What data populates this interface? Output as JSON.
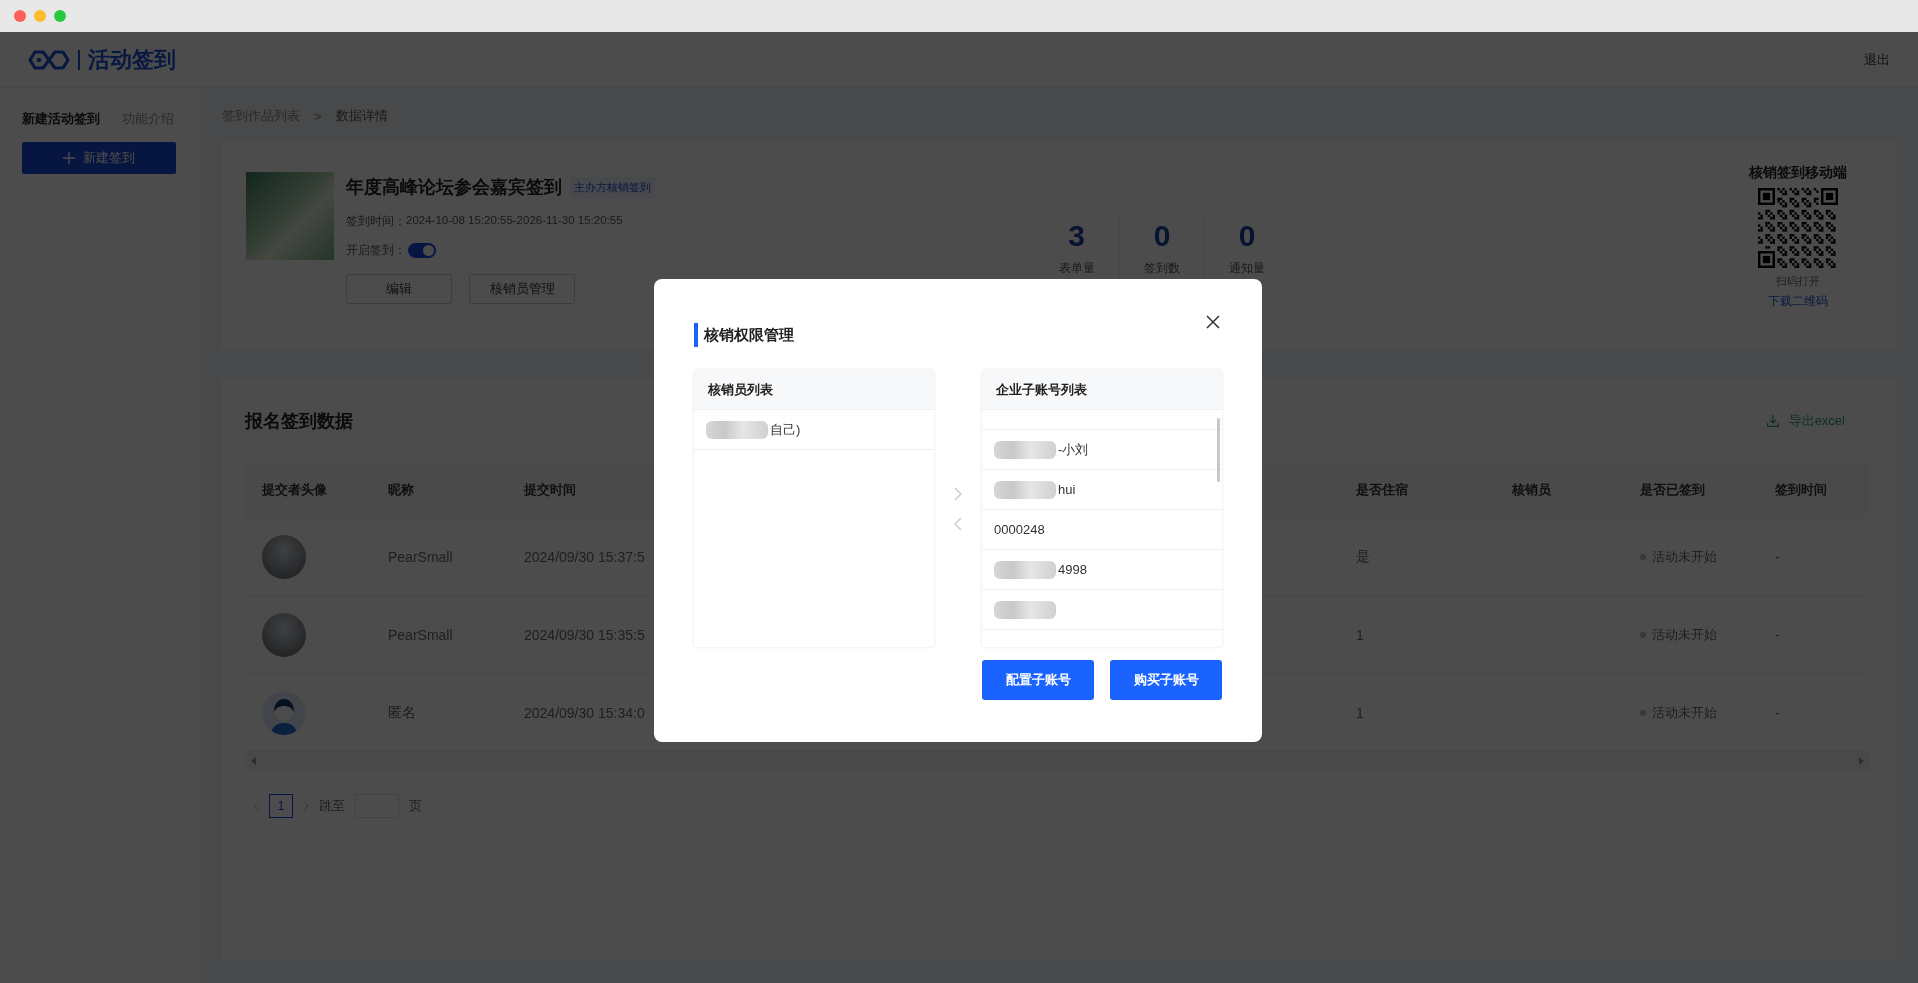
{
  "header": {
    "logo_text": "活动签到",
    "logout": "退出"
  },
  "sidebar": {
    "tabs": [
      {
        "label": "新建活动签到",
        "selected": true
      },
      {
        "label": "功能介绍",
        "selected": false
      }
    ],
    "new_button": "新建签到"
  },
  "breadcrumb": [
    "签到作品列表",
    ">",
    "数据详情"
  ],
  "event": {
    "title": "年度高峰论坛参会嘉宾签到",
    "tag": "主办方核销签到",
    "time_label": "签到时间：",
    "time": "2024-10-08 15:20:55-2026-11-30 15:20:55",
    "toggle_label": "开启签到：",
    "toggle_on": true,
    "buttons": [
      "编辑",
      "核销员管理"
    ]
  },
  "stats": [
    {
      "value": "3",
      "label": "表单量"
    },
    {
      "value": "0",
      "label": "签到数"
    },
    {
      "value": "0",
      "label": "通知量"
    }
  ],
  "mobile": {
    "title": "核销签到移动端",
    "caption": "扫码打开",
    "link": "下载二维码"
  },
  "data": {
    "title": "报名签到数据",
    "export": "导出excel",
    "columns": [
      "提交者头像",
      "昵称",
      "提交时间",
      "是否住宿",
      "核销员",
      "是否已签到",
      "签到时间"
    ],
    "rows": [
      {
        "kind": "photo",
        "nickname": "PearSmall",
        "submit_time": "2024/09/30 15:37:5",
        "lodging": "是",
        "status": "活动未开始",
        "checkin_time": "-"
      },
      {
        "kind": "photo",
        "nickname": "PearSmall",
        "submit_time": "2024/09/30 15:35:5",
        "lodging": "1",
        "status": "活动未开始",
        "checkin_time": "-"
      },
      {
        "kind": "default",
        "nickname": "匿名",
        "submit_time": "2024/09/30 15:34:0",
        "lodging": "1",
        "status": "活动未开始",
        "checkin_time": "-"
      }
    ],
    "pagination": {
      "pages": [
        {
          "label": "1",
          "selected": true
        }
      ],
      "jump_label": "跳至",
      "unit": "页"
    }
  },
  "modal": {
    "title": "核销权限管理",
    "left": {
      "title": "核销员列表",
      "items": [
        {
          "text": "自己)",
          "redacted": true
        }
      ]
    },
    "right": {
      "title": "企业子账号列表",
      "items": [
        {
          "text": "-小刘",
          "redacted": true
        },
        {
          "text": "hui",
          "redacted": true
        },
        {
          "text": "0000248",
          "redacted": false
        },
        {
          "text": "4998",
          "redacted": true
        },
        {
          "redacted": true
        }
      ]
    },
    "buttons": [
      "配置子账号",
      "购买子账号"
    ]
  }
}
